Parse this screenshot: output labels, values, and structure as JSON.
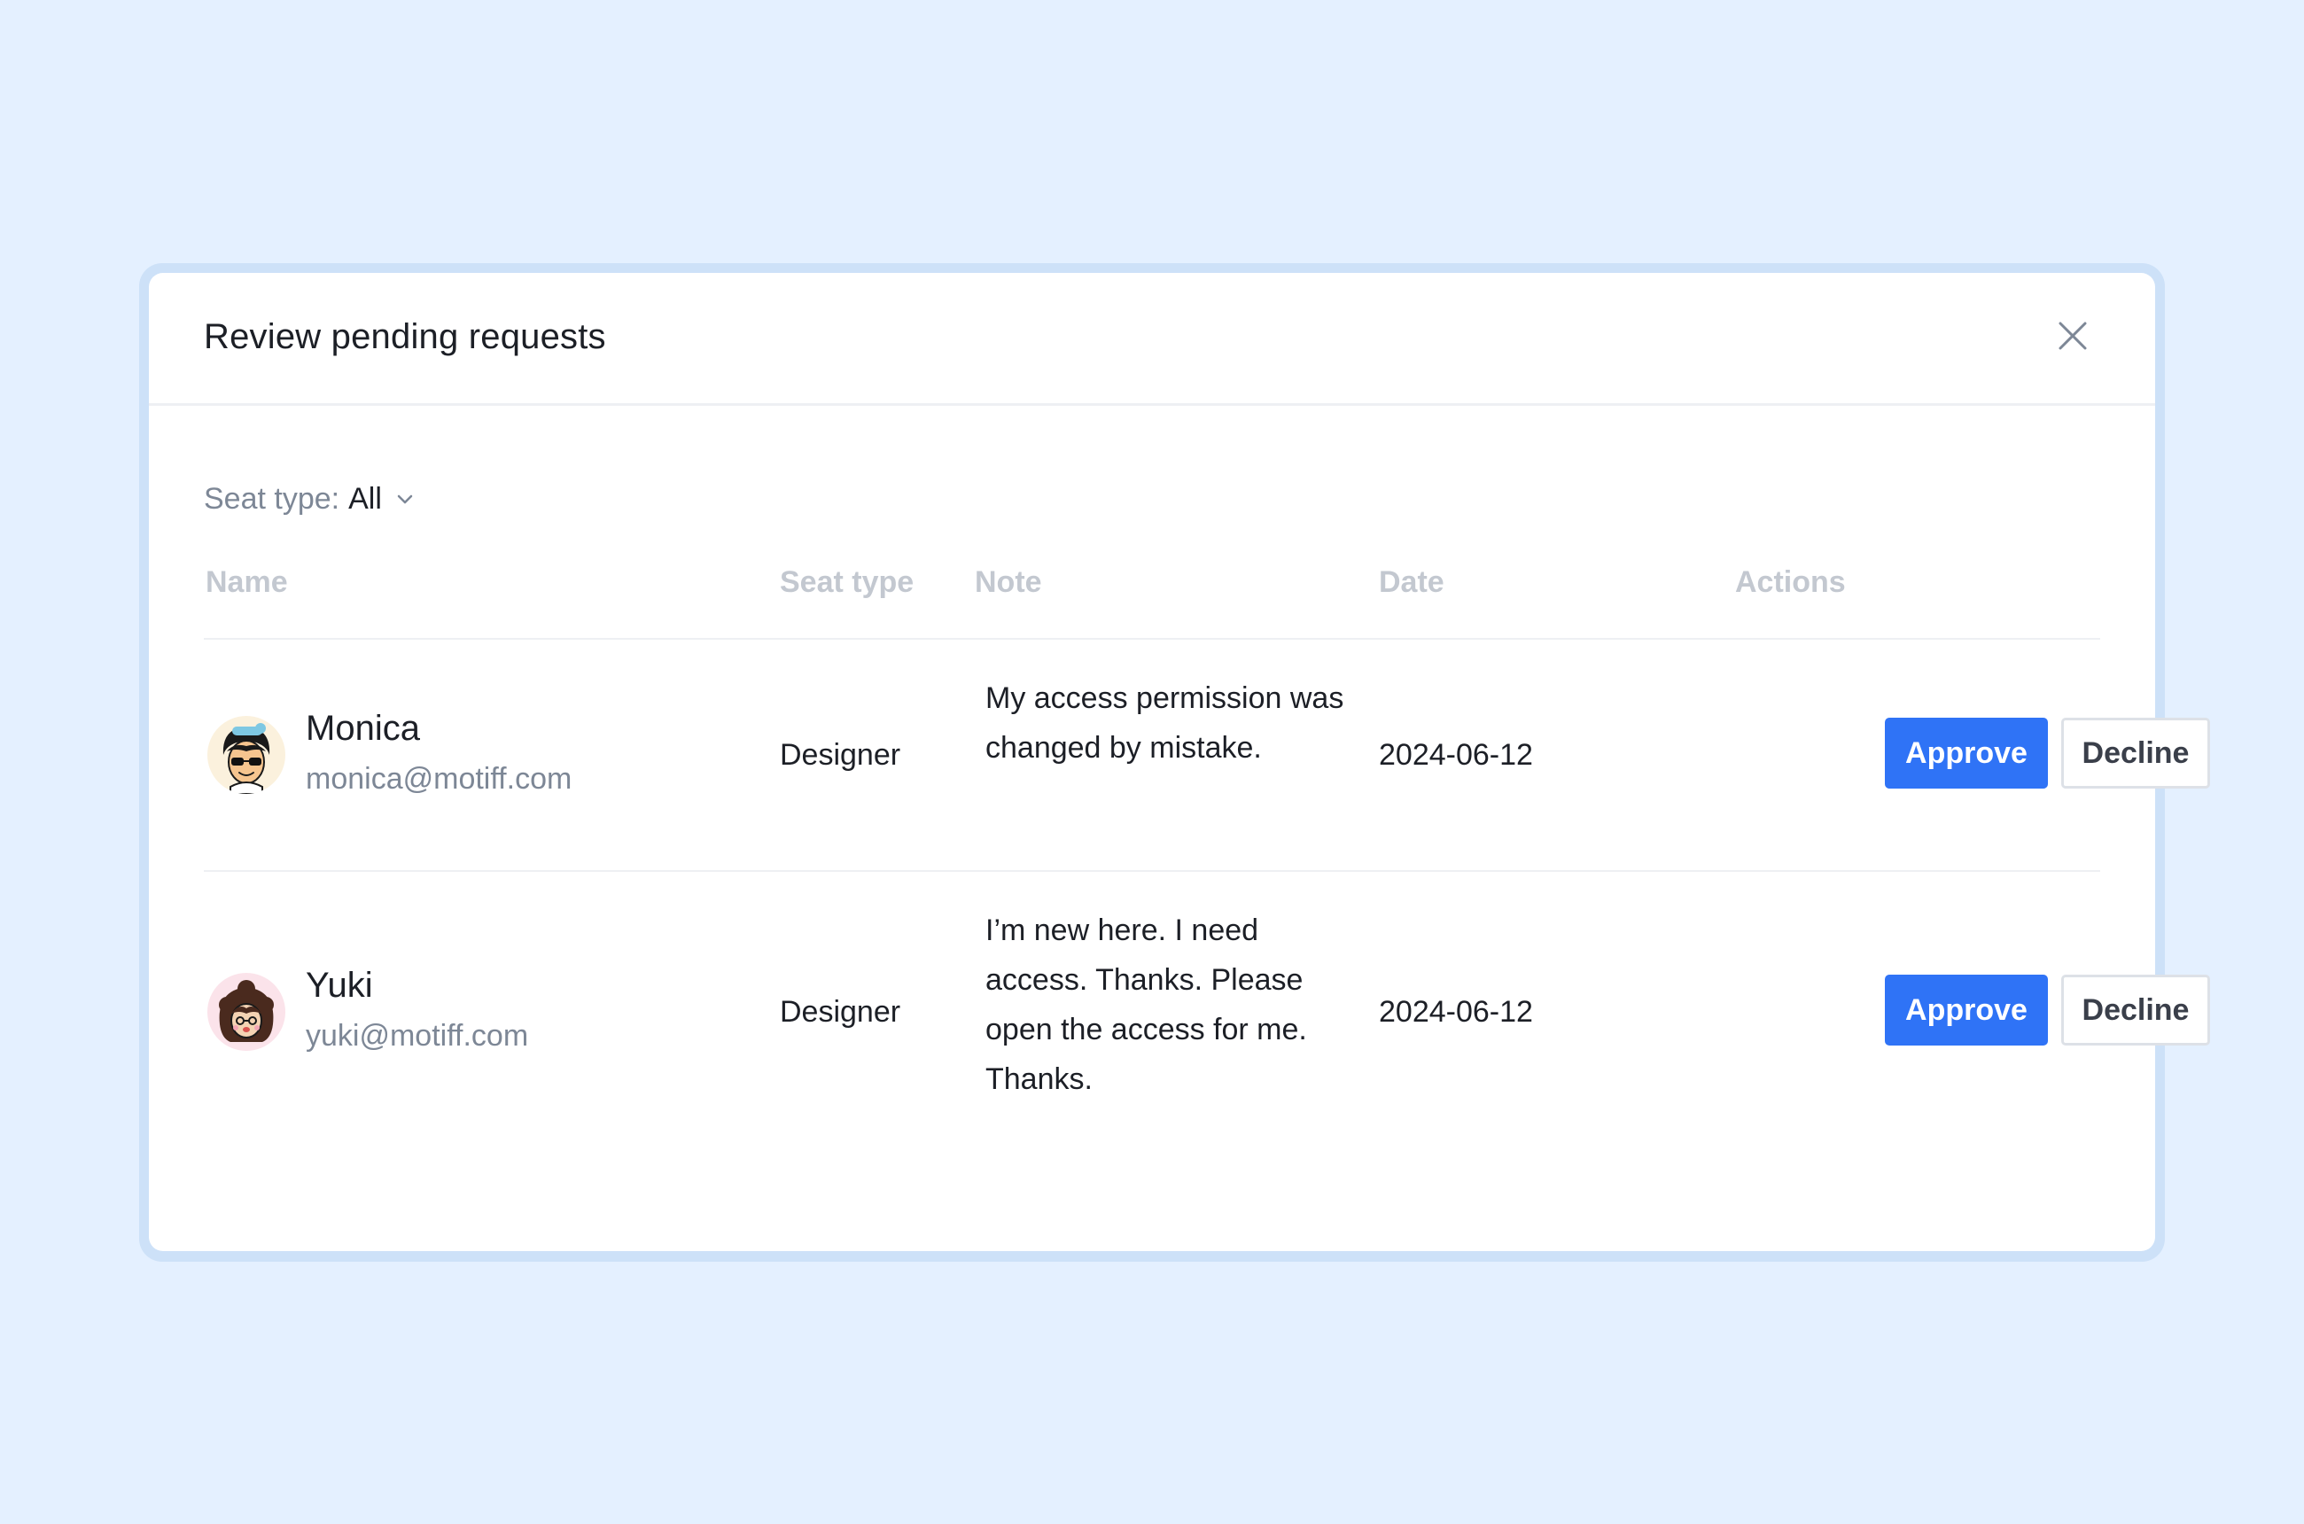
{
  "dialog": {
    "title": "Review pending requests",
    "close_icon": "close-icon"
  },
  "filter": {
    "label": "Seat type:",
    "value": "All",
    "icon": "chevron-down-icon"
  },
  "table": {
    "columns": [
      "Name",
      "Seat type",
      "Note",
      "Date",
      "Actions"
    ],
    "rows": [
      {
        "name": "Monica",
        "email": "monica@motiff.com",
        "avatar_icon": "avatar-monica-icon",
        "seat_type": "Designer",
        "note": "My access permission was changed by mistake.",
        "date": "2024-06-12",
        "approve_label": "Approve",
        "decline_label": "Decline"
      },
      {
        "name": "Yuki",
        "email": "yuki@motiff.com",
        "avatar_icon": "avatar-yuki-icon",
        "seat_type": "Designer",
        "note": "I’m new here. I need access. Thanks. Please open the access for me. Thanks.",
        "date": "2024-06-12",
        "approve_label": "Approve",
        "decline_label": "Decline"
      }
    ]
  },
  "colors": {
    "background": "#e4f0ff",
    "accent": "#2f73f6",
    "muted_text": "#7d8796",
    "header_text": "#c3c8d0"
  }
}
